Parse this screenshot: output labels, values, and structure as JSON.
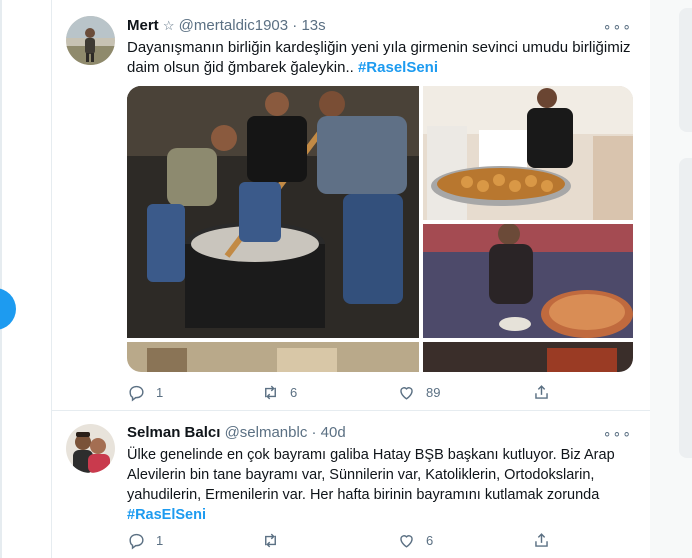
{
  "colors": {
    "accent": "#1d9bf0",
    "text": "#0f1419",
    "muted": "#5b7083",
    "border": "#e6ecf0"
  },
  "tweets": [
    {
      "name": "Mert",
      "badge": "☆",
      "handle": "@mertaldic1903",
      "dot": "·",
      "time": "13s",
      "more": "∘∘∘",
      "text": "Dayanışmanın birliğin kardeşliğin yeni yıla girmenin sevinci umudu birliğimiz daim olsun ğid ğmbarek ğaleykin..",
      "hashtag": "#RaselSeni",
      "media_icon": "photo-collage",
      "replies": "1",
      "retweets": "6",
      "likes": "89"
    },
    {
      "name": "Selman Balcı",
      "handle": "@selmanblc",
      "dot": "·",
      "time": "40d",
      "more": "∘∘∘",
      "text": "Ülke genelinde en çok bayramı galiba Hatay BŞB başkanı kutluyor. Biz Arap Alevilerin bin tane bayramı var, Sünnilerin var, Katoliklerin, Ortodokslarin, yahudilerin, Ermenilerin var.  Her hafta birinin bayramını kutlamak zorunda",
      "hashtag": "#RasElSeni",
      "replies": "1",
      "retweets": "",
      "likes": "6"
    }
  ],
  "icons": [
    "reply-icon",
    "retweet-icon",
    "like-icon",
    "share-icon",
    "more-icon"
  ]
}
